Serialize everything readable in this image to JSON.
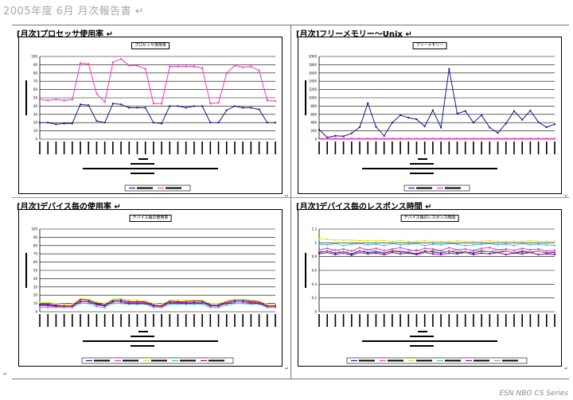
{
  "document": {
    "title": "2005年度 6月 月次報告書 ↵",
    "footer": "ESN NBO CS Series",
    "end_mark": "↵"
  },
  "colors": {
    "series_palette": [
      "#1a1a8c",
      "#ff33cc",
      "#e6e600",
      "#33cccc",
      "#990099",
      "#999999"
    ]
  },
  "panels": [
    {
      "title": "[月次]プロセッサ使用率 ↵",
      "chart_title": "プロセッサ使用率"
    },
    {
      "title": "[月次]フリーメモリー～Unix ↵",
      "chart_title": "フリーメモリー"
    },
    {
      "title": "[月次]デバイス毎の使用率 ↵",
      "chart_title": "デバイス毎の使用率"
    },
    {
      "title": "[月次]デバイス毎のレスポンス時間 ↵",
      "chart_title": "デバイス毎のレスポンス時間"
    }
  ],
  "chart_data": [
    {
      "type": "line",
      "title": "プロセッサ使用率",
      "ylim": [
        0,
        100
      ],
      "yticks": [
        0,
        10,
        20,
        30,
        40,
        50,
        60,
        70,
        80,
        90,
        100
      ],
      "grid": true,
      "legend_position": "bottom",
      "n_points": 30,
      "series": [
        {
          "values": [
            20,
            20,
            18,
            19,
            19,
            42,
            41,
            22,
            20,
            43,
            42,
            38,
            38,
            38,
            20,
            19,
            40,
            40,
            38,
            40,
            40,
            20,
            20,
            35,
            40,
            38,
            38,
            36,
            20,
            20
          ]
        },
        {
          "values": [
            48,
            47,
            48,
            47,
            48,
            92,
            91,
            55,
            45,
            93,
            97,
            89,
            89,
            85,
            43,
            43,
            88,
            88,
            88,
            88,
            86,
            43,
            44,
            80,
            89,
            87,
            88,
            83,
            47,
            46
          ]
        }
      ]
    },
    {
      "type": "line",
      "title": "フリーメモリー",
      "ylim": [
        0,
        2000
      ],
      "yticks": [
        0,
        200,
        400,
        600,
        800,
        1000,
        1200,
        1400,
        1600,
        1800,
        2000
      ],
      "grid": true,
      "legend_position": "bottom",
      "n_points": 30,
      "series": [
        {
          "values": [
            230,
            40,
            80,
            70,
            140,
            290,
            870,
            300,
            80,
            400,
            580,
            520,
            480,
            310,
            700,
            280,
            1700,
            620,
            680,
            400,
            580,
            280,
            150,
            380,
            680,
            470,
            690,
            410,
            290,
            360
          ]
        },
        {
          "values": [
            15,
            15,
            15,
            15,
            15,
            15,
            15,
            15,
            15,
            15,
            15,
            15,
            15,
            15,
            15,
            15,
            15,
            15,
            15,
            15,
            15,
            15,
            15,
            15,
            15,
            15,
            15,
            15,
            15,
            15
          ]
        }
      ]
    },
    {
      "type": "line",
      "title": "デバイス毎の使用率",
      "ylim": [
        0,
        100
      ],
      "yticks": [
        0,
        10,
        20,
        30,
        40,
        50,
        60,
        70,
        80,
        90,
        100
      ],
      "grid": true,
      "legend_position": "bottom",
      "n_points": 30,
      "series": [
        {
          "values": [
            9,
            9,
            8,
            7,
            7,
            15,
            14,
            10,
            8,
            14,
            14,
            12,
            12,
            12,
            8,
            7,
            13,
            12,
            12,
            13,
            13,
            8,
            8,
            12,
            14,
            14,
            13,
            12,
            7,
            7
          ]
        },
        {
          "values": [
            7,
            7,
            6,
            6,
            6,
            13,
            12,
            8,
            7,
            12,
            12,
            11,
            11,
            11,
            7,
            6,
            11,
            11,
            11,
            11,
            11,
            7,
            7,
            11,
            12,
            12,
            12,
            11,
            6,
            6
          ]
        },
        {
          "values": [
            11,
            11,
            10,
            9,
            9,
            16,
            15,
            12,
            10,
            15,
            16,
            14,
            14,
            13,
            10,
            9,
            14,
            14,
            14,
            14,
            14,
            10,
            10,
            13,
            15,
            15,
            14,
            13,
            9,
            9
          ]
        },
        {
          "values": [
            5,
            5,
            5,
            5,
            5,
            10,
            10,
            6,
            5,
            10,
            10,
            9,
            9,
            9,
            5,
            5,
            9,
            9,
            9,
            9,
            9,
            5,
            5,
            8,
            10,
            10,
            9,
            9,
            5,
            5
          ]
        },
        {
          "values": [
            8,
            8,
            7,
            7,
            7,
            12,
            12,
            9,
            7,
            12,
            12,
            10,
            10,
            10,
            7,
            7,
            11,
            11,
            10,
            11,
            11,
            7,
            7,
            10,
            12,
            12,
            11,
            10,
            7,
            7
          ]
        }
      ]
    },
    {
      "type": "line",
      "title": "デバイス毎のレスポンス時間",
      "ylim": [
        0,
        1.2
      ],
      "yticks": [
        0,
        0.2,
        0.4,
        0.6,
        0.8,
        1.0,
        1.2
      ],
      "grid": true,
      "legend_position": "bottom",
      "n_points": 30,
      "series": [
        {
          "values": [
            0.86,
            0.88,
            0.85,
            0.87,
            0.84,
            0.88,
            0.86,
            0.87,
            0.85,
            0.88,
            0.87,
            0.86,
            0.84,
            0.88,
            0.87,
            0.85,
            0.88,
            0.86,
            0.87,
            0.85,
            0.88,
            0.87,
            0.86,
            0.88,
            0.85,
            0.87,
            0.86,
            0.88,
            0.85,
            0.86
          ]
        },
        {
          "values": [
            0.9,
            0.92,
            0.89,
            0.91,
            0.88,
            0.93,
            0.9,
            0.92,
            0.89,
            0.91,
            0.93,
            0.9,
            0.88,
            0.92,
            0.91,
            0.89,
            0.93,
            0.9,
            0.91,
            0.89,
            0.92,
            0.93,
            0.9,
            0.91,
            0.89,
            0.92,
            0.9,
            0.91,
            0.88,
            0.89
          ]
        },
        {
          "values": [
            1.06,
            1.05,
            1.04,
            1.04,
            1.04,
            1.03,
            1.03,
            1.03,
            1.03,
            1.02,
            1.03,
            1.02,
            1.02,
            1.03,
            1.02,
            1.02,
            1.02,
            1.03,
            1.02,
            1.02,
            1.02,
            1.03,
            1.02,
            1.02,
            1.02,
            1.02,
            1.03,
            1.02,
            1.02,
            1.02
          ]
        },
        {
          "values": [
            0.98,
            0.97,
            0.99,
            0.96,
            0.98,
            0.99,
            0.97,
            0.98,
            0.96,
            0.99,
            0.97,
            0.98,
            0.99,
            0.96,
            0.98,
            0.97,
            0.99,
            0.98,
            0.96,
            0.97,
            0.98,
            0.99,
            0.97,
            0.98,
            0.96,
            0.99,
            0.97,
            0.98,
            0.97,
            0.96
          ]
        },
        {
          "values": [
            0.84,
            0.86,
            0.83,
            0.85,
            0.82,
            0.86,
            0.84,
            0.85,
            0.83,
            0.86,
            0.84,
            0.85,
            0.83,
            0.86,
            0.84,
            0.83,
            0.85,
            0.84,
            0.86,
            0.83,
            0.85,
            0.84,
            0.86,
            0.83,
            0.85,
            0.84,
            0.86,
            0.83,
            0.84,
            0.83
          ]
        },
        {
          "values": [
            0.88,
            0.87,
            0.9,
            0.86,
            0.89,
            0.87,
            0.9,
            0.88,
            0.86,
            0.89,
            0.88,
            0.87,
            0.9,
            0.86,
            0.89,
            0.88,
            0.87,
            0.9,
            0.86,
            0.88,
            0.89,
            0.87,
            0.9,
            0.88,
            0.86,
            0.89,
            0.87,
            0.88,
            0.86,
            0.87
          ]
        }
      ]
    }
  ]
}
